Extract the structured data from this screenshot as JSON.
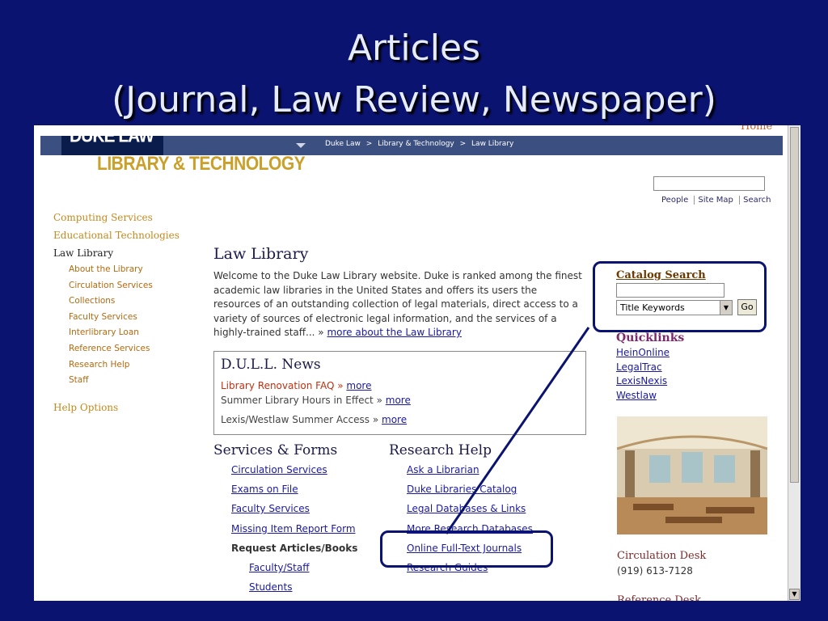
{
  "slide": {
    "title_line1": "Articles",
    "title_line2": "(Journal, Law Review, Newspaper)"
  },
  "header": {
    "home_link": "Home",
    "logo_line1": "DUKE LAW",
    "logo_line2": "LIBRARY & TECHNOLOGY",
    "breadcrumbs": [
      "Duke Law",
      ">",
      "Library & Technology",
      ">",
      "Law Library"
    ],
    "util_links": [
      "People",
      "Site Map",
      "Search"
    ]
  },
  "sidebar": {
    "top_items": [
      "Computing Services",
      "Educational Technologies"
    ],
    "current": "Law Library",
    "sub_items": [
      "About the Library",
      "Circulation Services",
      "Collections",
      "Faculty Services",
      "Interlibrary Loan",
      "Reference Services",
      "Research Help",
      "Staff"
    ],
    "help": "Help Options"
  },
  "main": {
    "heading": "Law Library",
    "intro": "Welcome to the Duke Law Library website. Duke is ranked among the finest academic law libraries in the United States and offers its users the resources of an outstanding collection of legal materials, direct access to a variety of sources of electronic legal information, and the services of a highly-trained staff... »",
    "intro_link": "more about the Law Library",
    "news": {
      "title": "D.U.L.L. News",
      "items": [
        {
          "text": "Library Renovation FAQ »",
          "link": "more"
        },
        {
          "text": "Summer Library Hours in Effect »",
          "link": "more"
        },
        {
          "text": "Lexis/Westlaw Summer Access »",
          "link": "more"
        }
      ]
    },
    "services": {
      "title": "Services & Forms",
      "links": [
        "Circulation Services",
        "Exams on File",
        "Faculty Services",
        "Missing Item Report Form"
      ],
      "request_label": "Request Articles/Books",
      "request_links": [
        "Faculty/Staff",
        "Students"
      ]
    },
    "research": {
      "title": "Research Help",
      "links": [
        "Ask a Librarian",
        "Duke Libraries Catalog",
        "Legal Databases & Links",
        "More Research Databases",
        "Online Full-Text Journals",
        "Research Guides"
      ]
    }
  },
  "right": {
    "catalog_title": "Catalog Search",
    "catalog_select": "Title Keywords",
    "go": "Go",
    "quick_title": "Quicklinks",
    "quick_links": [
      "HeinOnline",
      "LegalTrac",
      "LexisNexis",
      "Westlaw"
    ],
    "circ_title": "Circulation Desk",
    "circ_phone": "(919) 613-7128",
    "ref_title": "Reference Desk"
  },
  "colors": {
    "slide_bg": "#0b1370",
    "topbar": "#3b4f80",
    "logo_gold": "#caa02a",
    "link": "#1a1aa0"
  }
}
